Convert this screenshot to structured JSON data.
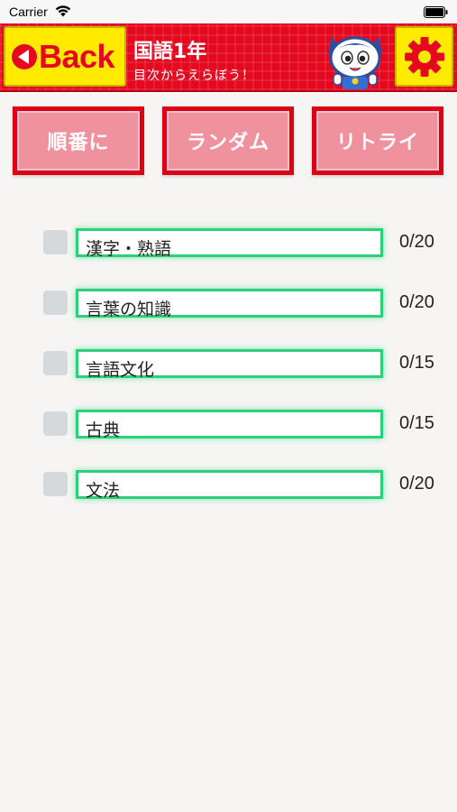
{
  "status_bar": {
    "carrier": "Carrier"
  },
  "header": {
    "back_label": "Back",
    "title": "国語1年",
    "subtitle": "目次からえらぼう！",
    "icons": {
      "back": "back-arrow-icon",
      "mascot": "cat-mascot-icon",
      "settings": "gear-icon"
    },
    "colors": {
      "bar": "#e5091f",
      "button": "#ffea00"
    }
  },
  "modes": [
    {
      "label": "順番に"
    },
    {
      "label": "ランダム"
    },
    {
      "label": "リトライ"
    }
  ],
  "chapters": [
    {
      "label": "漢字・熟語",
      "progress": "0/20"
    },
    {
      "label": "言葉の知識",
      "progress": "0/20"
    },
    {
      "label": "言語文化",
      "progress": "0/15"
    },
    {
      "label": "古典",
      "progress": "0/15"
    },
    {
      "label": "文法",
      "progress": "0/20"
    }
  ]
}
